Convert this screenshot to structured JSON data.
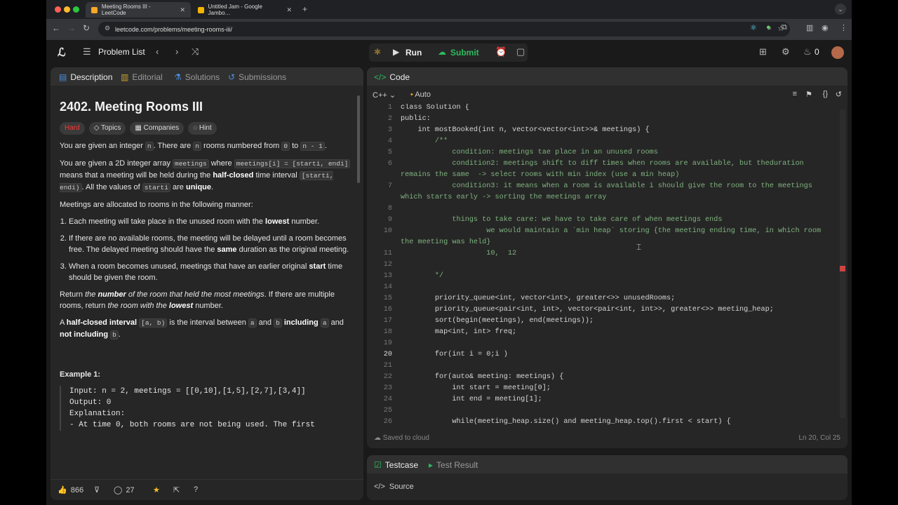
{
  "browser": {
    "tabs": [
      {
        "title": "Meeting Rooms III - LeetCode",
        "active": true
      },
      {
        "title": "Untitled Jam - Google Jambo…",
        "active": false
      }
    ],
    "url": "leetcode.com/problems/meeting-rooms-iii/"
  },
  "topbar": {
    "problem_list": "Problem List",
    "run": "Run",
    "submit": "Submit",
    "streak": "0"
  },
  "desc_tabs": [
    "Description",
    "Editorial",
    "Solutions",
    "Submissions"
  ],
  "problem": {
    "title": "2402. Meeting Rooms III",
    "difficulty": "Hard",
    "chips": [
      "Topics",
      "Companies",
      "Hint"
    ],
    "p1_a": "You are given an integer ",
    "p1_n": "n",
    "p1_b": ". There are ",
    "p1_c": " rooms numbered from ",
    "p1_zero": "0",
    "p1_d": " to ",
    "p1_nm1": "n - 1",
    "p1_e": ".",
    "p2_a": "You are given a 2D integer array ",
    "p2_code1": "meetings",
    "p2_b": " where ",
    "p2_code2": "meetings[i] = [starti, endi]",
    "p2_c": " means that a meeting will be held during the ",
    "p2_bold": "half-closed",
    "p2_d": " time interval ",
    "p2_code3": "[starti, endi)",
    "p2_e": ". All the values of ",
    "p2_code4": "starti",
    "p2_f": " are ",
    "p2_bold2": "unique",
    "p2_g": ".",
    "p3": "Meetings are allocated to rooms in the following manner:",
    "li1_a": "Each meeting will take place in the unused room with the ",
    "li1_b": "lowest",
    "li1_c": " number.",
    "li2_a": "If there are no available rooms, the meeting will be delayed until a room becomes free. The delayed meeting should have the ",
    "li2_b": "same",
    "li2_c": " duration as the original meeting.",
    "li3_a": "When a room becomes unused, meetings that have an earlier original ",
    "li3_b": "start",
    "li3_c": " time should be given the room.",
    "p4_a": "Return ",
    "p4_b": "the ",
    "p4_c": "number",
    "p4_d": " of the room that held the most meetings",
    "p4_e": ". If there are multiple rooms, return ",
    "p4_f": "the room with the ",
    "p4_g": "lowest",
    "p4_h": " number.",
    "p5_a": "A ",
    "p5_b": "half-closed interval",
    "p5_c": " ",
    "p5_code1": "[a, b)",
    "p5_d": " is the interval between ",
    "p5_code2": "a",
    "p5_e": " and ",
    "p5_code3": "b",
    "p5_f": " ",
    "p5_g": "including",
    "p5_h": " ",
    "p5_code4": "a",
    "p5_i": " and ",
    "p5_j": "not including",
    "p5_k": " ",
    "p5_code5": "b",
    "p5_l": ".",
    "example_title": "Example 1:",
    "example_lines": [
      "Input: n = 2, meetings = [[0,10],[1,5],[2,7],[3,4]]",
      "Output: 0",
      "Explanation:",
      "- At time 0, both rooms are not being used. The first"
    ]
  },
  "desc_footer": {
    "likes": "866",
    "comments": "27"
  },
  "code_panel": {
    "title": "Code",
    "language": "C++",
    "mode": "Auto",
    "saved": "Saved to cloud",
    "cursor": "Ln 20, Col 25",
    "current_line": 20
  },
  "code_lines": [
    {
      "n": "1",
      "t": "class Solution {"
    },
    {
      "n": "2",
      "t": "public:"
    },
    {
      "n": "3",
      "t": "    int mostBooked(int n, vector<vector<int>>& meetings) {"
    },
    {
      "n": "4",
      "t": "        /**"
    },
    {
      "n": "5",
      "t": "            condition: meetings tae place in an unused rooms"
    },
    {
      "n": "6",
      "t": "            condition2: meetings shift to diff times when rooms are available, but theduration"
    },
    {
      "n": "",
      "t": "remains the same  -> select rooms with min index (use a min heap)"
    },
    {
      "n": "7",
      "t": "            condition3: it means when a room is available i should give the room to the meetings"
    },
    {
      "n": "",
      "t": "which starts early -> sorting the meetings array"
    },
    {
      "n": "8",
      "t": ""
    },
    {
      "n": "9",
      "t": "            things to take care: we have to take care of when meetings ends"
    },
    {
      "n": "10",
      "t": "                    we would maintain a `min heap` storing {the meeting ending time, in which room"
    },
    {
      "n": "",
      "t": "the meeting was held}"
    },
    {
      "n": "11",
      "t": "                    10,  12"
    },
    {
      "n": "12",
      "t": ""
    },
    {
      "n": "13",
      "t": "        */"
    },
    {
      "n": "14",
      "t": ""
    },
    {
      "n": "15",
      "t": "        priority_queue<int, vector<int>, greater<>> unusedRooms;"
    },
    {
      "n": "16",
      "t": "        priority_queue<pair<int, int>, vector<pair<int, int>>, greater<>> meeting_heap;"
    },
    {
      "n": "17",
      "t": "        sort(begin(meetings), end(meetings));"
    },
    {
      "n": "18",
      "t": "        map<int, int> freq;"
    },
    {
      "n": "19",
      "t": ""
    },
    {
      "n": "20",
      "t": "        for(int i = 0;i )"
    },
    {
      "n": "21",
      "t": ""
    },
    {
      "n": "22",
      "t": "        for(auto& meeting: meetings) {"
    },
    {
      "n": "23",
      "t": "            int start = meeting[0];"
    },
    {
      "n": "24",
      "t": "            int end = meeting[1];"
    },
    {
      "n": "25",
      "t": ""
    },
    {
      "n": "26",
      "t": "            while(meeting_heap.size() and meeting_heap.top().first < start) {"
    }
  ],
  "comment_line_indexes": [
    3,
    4,
    5,
    6,
    7,
    8,
    10,
    11,
    12,
    13,
    15
  ],
  "bottom_tabs": [
    "Testcase",
    "Test Result"
  ],
  "source_label": "Source"
}
